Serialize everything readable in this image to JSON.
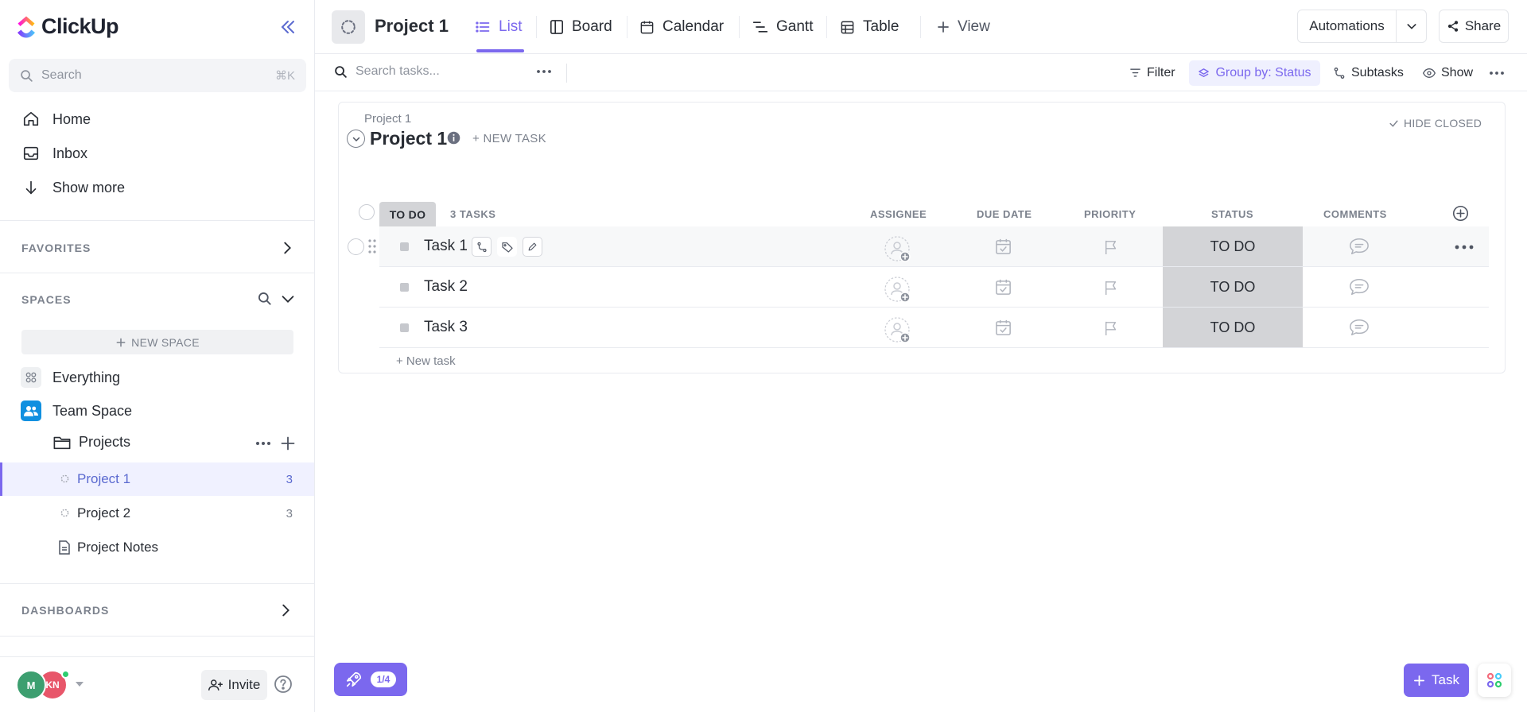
{
  "app": {
    "name": "ClickUp"
  },
  "sidebar": {
    "search": {
      "placeholder": "Search",
      "shortcut": "⌘K"
    },
    "nav": [
      {
        "label": "Home",
        "icon": "home-icon"
      },
      {
        "label": "Inbox",
        "icon": "inbox-icon"
      },
      {
        "label": "Show more",
        "icon": "arrow-down-icon"
      }
    ],
    "favorites_title": "FAVORITES",
    "spaces_title": "SPACES",
    "new_space_label": "NEW SPACE",
    "everything_label": "Everything",
    "team_space_label": "Team Space",
    "folder_label": "Projects",
    "lists": [
      {
        "label": "Project 1",
        "count": "3",
        "active": true
      },
      {
        "label": "Project 2",
        "count": "3",
        "active": false
      }
    ],
    "doc_label": "Project Notes",
    "dashboards_title": "DASHBOARDS",
    "avatars": [
      {
        "initials": "M",
        "color": "#3d9f70"
      },
      {
        "initials": "KN",
        "color": "#e8566a"
      }
    ],
    "invite_label": "Invite"
  },
  "header": {
    "project_title": "Project 1",
    "tabs": [
      {
        "label": "List",
        "active": true,
        "icon": "list-icon"
      },
      {
        "label": "Board",
        "active": false,
        "icon": "board-icon"
      },
      {
        "label": "Calendar",
        "active": false,
        "icon": "calendar-icon"
      },
      {
        "label": "Gantt",
        "active": false,
        "icon": "gantt-icon"
      },
      {
        "label": "Table",
        "active": false,
        "icon": "table-icon"
      }
    ],
    "add_view_label": "View",
    "automations_label": "Automations",
    "share_label": "Share"
  },
  "toolbar": {
    "search_placeholder": "Search tasks...",
    "filter_label": "Filter",
    "group_by_label": "Group by: Status",
    "subtasks_label": "Subtasks",
    "show_label": "Show"
  },
  "list": {
    "breadcrumb": "Project 1",
    "title": "Project 1",
    "new_task_top": "+ NEW TASK",
    "hide_closed": "HIDE CLOSED",
    "group": {
      "status": "TO DO",
      "count_label": "3 TASKS"
    },
    "columns": {
      "assignee": "ASSIGNEE",
      "due_date": "DUE DATE",
      "priority": "PRIORITY",
      "status": "STATUS",
      "comments": "COMMENTS"
    },
    "tasks": [
      {
        "name": "Task 1",
        "status": "TO DO"
      },
      {
        "name": "Task 2",
        "status": "TO DO"
      },
      {
        "name": "Task 3",
        "status": "TO DO"
      }
    ],
    "new_task_bottom": "+ New task"
  },
  "floating": {
    "onboarding_progress": "1/4",
    "task_button_label": "Task"
  },
  "colors": {
    "accent": "#7b68ee",
    "status_todo": "#d3d4d7"
  }
}
